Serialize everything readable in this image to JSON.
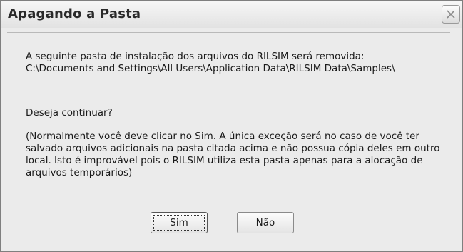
{
  "dialog": {
    "title": "Apagando a Pasta",
    "close_icon": "close-icon",
    "message_intro": "A seguinte pasta de instalação dos arquivos do RILSIM será removida:",
    "message_path": "C:\\Documents and Settings\\All Users\\Application Data\\RILSIM Data\\Samples\\",
    "question": "Deseja continuar?",
    "note": "(Normalmente você deve clicar no Sim. A única exceção será no caso de você ter salvado arquivos adicionais na pasta citada acima e não possua cópia deles em outro local. Isto é improvável pois o RILSIM utiliza esta pasta apenas para a alocação de arquivos temporários)",
    "buttons": {
      "yes_label": "Sim",
      "no_label": "Não"
    }
  }
}
